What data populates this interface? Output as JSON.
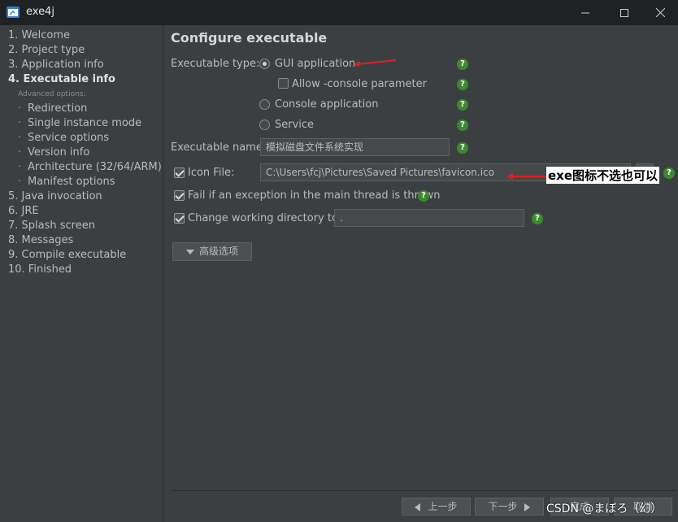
{
  "window": {
    "title": "exe4j"
  },
  "nav": [
    {
      "label": "1. Welcome"
    },
    {
      "label": "2. Project type"
    },
    {
      "label": "3. Application info"
    },
    {
      "label": "4. Executable info",
      "active": true
    },
    {
      "label": "5. Java invocation"
    },
    {
      "label": "6. JRE"
    },
    {
      "label": "7. Splash screen"
    },
    {
      "label": "8. Messages"
    },
    {
      "label": "9. Compile executable"
    },
    {
      "label": "10. Finished"
    }
  ],
  "advanced": {
    "heading": "Advanced options:",
    "items": [
      "Redirection",
      "Single instance mode",
      "Service options",
      "Version info",
      "Architecture (32/64/ARM)",
      "Manifest options"
    ]
  },
  "main": {
    "heading": "Configure executable",
    "exe_type_label": "Executable type:",
    "gui_label": "GUI application",
    "allow_console_label": "Allow -console parameter",
    "console_label": "Console application",
    "service_label": "Service",
    "exe_name_label": "Executable name:",
    "exe_name_value": "模拟磁盘文件系统实现",
    "icon_file_label": "Icon File:",
    "icon_file_value": "C:\\Users\\fcj\\Pictures\\Saved Pictures\\favicon.ico",
    "fail_label": "Fail if an exception in the main thread is thrown",
    "change_dir_label": "Change working directory to:",
    "change_dir_value": ".",
    "advanced_button": "高级选项",
    "help_glyph": "?"
  },
  "footer": {
    "prev": "上一步",
    "next": "下一步",
    "finish": "完成",
    "cancel": "取消"
  },
  "annotation": "exe图标不选也可以",
  "watermark": "CSDN @まぼろ（幻）"
}
